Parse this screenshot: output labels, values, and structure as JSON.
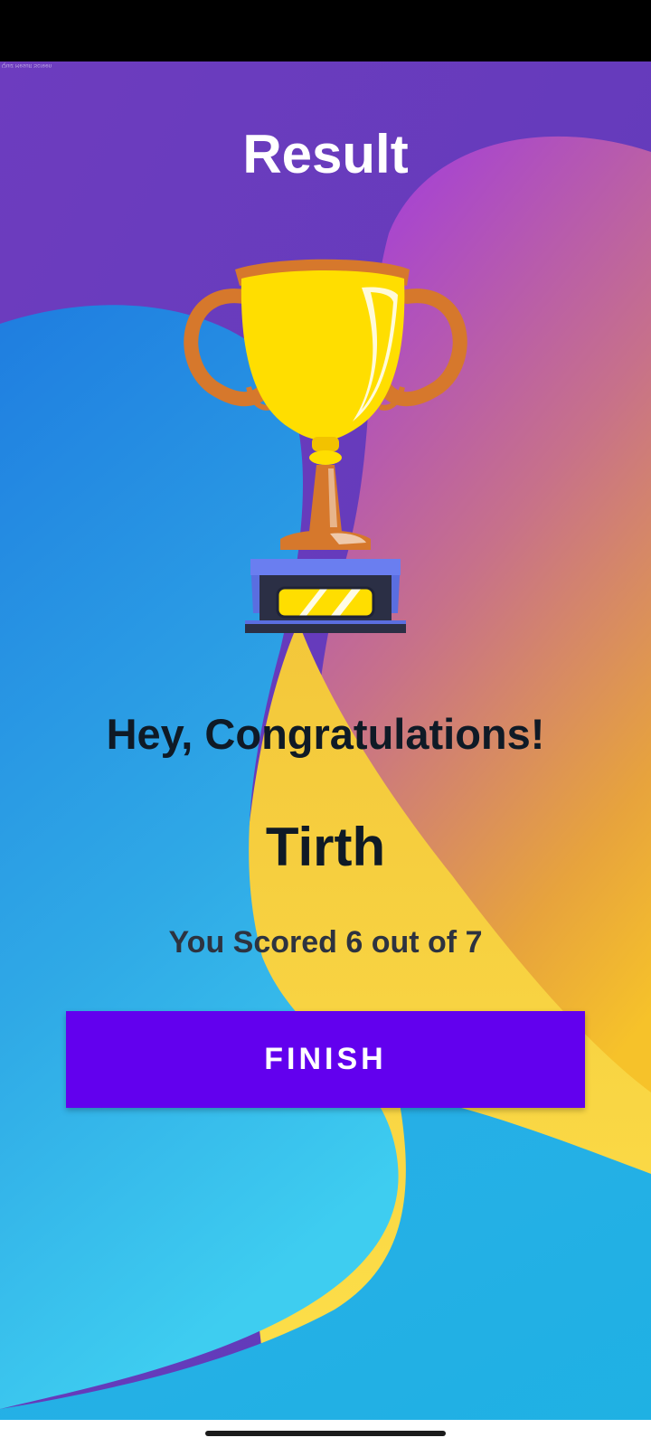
{
  "app": {
    "title": "Result",
    "corner_label": "Quiz Result Screen"
  },
  "result": {
    "congrats": "Hey, Congratulations!",
    "name": "Tirth",
    "score_text": "You Scored 6 out of 7",
    "score": 6,
    "total": 7
  },
  "actions": {
    "finish_label": "FINISH"
  },
  "icons": {
    "trophy": "trophy-icon"
  },
  "colors": {
    "accent_button": "#6200ee",
    "title_text": "#ffffff",
    "body_text": "#0f1a26",
    "bg_purple": "#6a3cc0",
    "bg_blue": "#1e88e5",
    "bg_yellow": "#fbd23c"
  }
}
